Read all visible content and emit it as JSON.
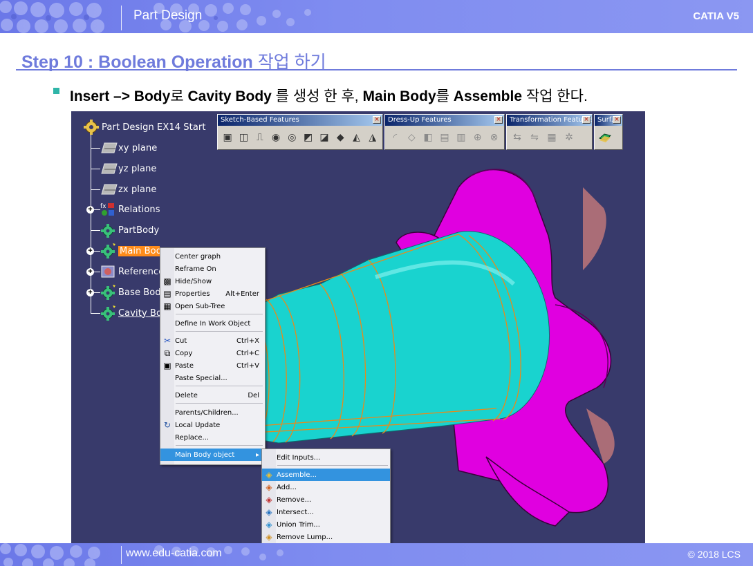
{
  "header": {
    "title": "Part Design",
    "brand": "CATIA V5"
  },
  "step": {
    "title_bold": "Step 10 : Boolean Operation",
    "title_rest": " 작업 하기"
  },
  "bullet": {
    "p1": "Insert –> Body",
    "p2": "로 ",
    "p3": "Cavity Body",
    "p4": " 를 생성 한 후, ",
    "p5": "Main Body",
    "p6": "를 ",
    "p7": "Assemble",
    "p8": " 작업 한다."
  },
  "tree": {
    "root": "Part Design EX14 Start",
    "items": [
      "xy plane",
      "yz plane",
      "zx plane",
      "Relations",
      "PartBody",
      "Main Body",
      "Reference",
      "Base Body",
      "Cavity Body"
    ]
  },
  "toolbars": [
    {
      "title": "Sketch-Based Features"
    },
    {
      "title": "Dress-Up Features"
    },
    {
      "title": "Transformation Features"
    },
    {
      "title": "Surf..."
    }
  ],
  "context_menu": {
    "items": [
      {
        "label": "Center graph",
        "shortcut": ""
      },
      {
        "label": "Reframe On",
        "shortcut": ""
      },
      {
        "label": "Hide/Show",
        "shortcut": ""
      },
      {
        "label": "Properties",
        "shortcut": "Alt+Enter"
      },
      {
        "label": "Open Sub-Tree",
        "shortcut": ""
      },
      {
        "label": "Define In Work Object",
        "shortcut": ""
      },
      {
        "label": "Cut",
        "shortcut": "Ctrl+X"
      },
      {
        "label": "Copy",
        "shortcut": "Ctrl+C"
      },
      {
        "label": "Paste",
        "shortcut": "Ctrl+V"
      },
      {
        "label": "Paste Special...",
        "shortcut": ""
      },
      {
        "label": "Delete",
        "shortcut": "Del"
      },
      {
        "label": "Parents/Children...",
        "shortcut": ""
      },
      {
        "label": "Local Update",
        "shortcut": ""
      },
      {
        "label": "Replace...",
        "shortcut": ""
      },
      {
        "label": "Main Body object",
        "shortcut": ""
      }
    ]
  },
  "submenu": {
    "items": [
      "Edit Inputs...",
      "Assemble...",
      "Add...",
      "Remove...",
      "Intersect...",
      "Union Trim...",
      "Remove Lump..."
    ]
  },
  "footer": {
    "website": "www.edu-catia.com",
    "copyright": "© 2018 LCS"
  },
  "colors": {
    "header_bar": "#7f8cf0",
    "title_blue": "#6f7bdc",
    "viewport_bg": "#383a6b",
    "part_cyan": "#19d3cf",
    "part_magenta": "#e000e0",
    "menu_highlight": "#3393df"
  }
}
